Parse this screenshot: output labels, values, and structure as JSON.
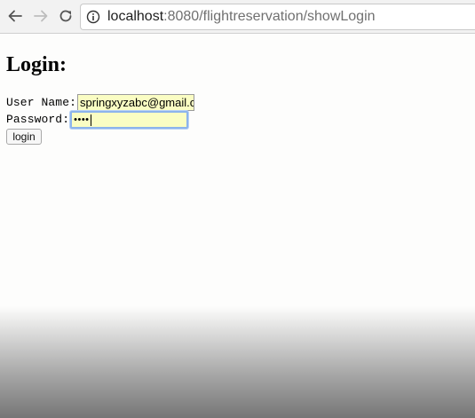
{
  "browser": {
    "url_host": "localhost",
    "url_rest": ":8080/flightreservation/showLogin"
  },
  "page": {
    "title": "Login:",
    "form": {
      "username_label": "User Name:",
      "username_value": "springxyzabc@gmail.com",
      "password_label": "Password:",
      "password_mask": "••••",
      "submit_label": "login"
    }
  },
  "icons": {
    "back": "arrow-left-icon",
    "forward": "arrow-right-icon",
    "reload": "reload-icon",
    "site_info": "info-circle-icon"
  },
  "colors": {
    "autofill_bg": "#fafdc3",
    "focus_ring": "#8db4ec"
  }
}
